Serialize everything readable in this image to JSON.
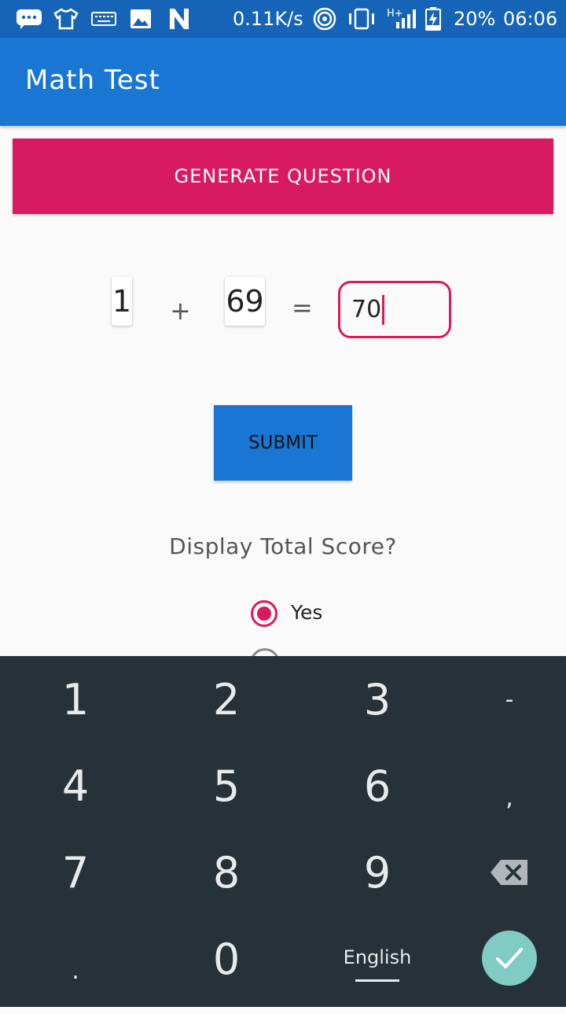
{
  "status_bar": {
    "network_speed": "0.11K/s",
    "network_type": "H+",
    "battery_percent": "20%",
    "time": "06:06",
    "icons": [
      "messages-icon",
      "tshirt-icon",
      "keyboard-icon",
      "image-icon",
      "n-icon",
      "hotspot-icon",
      "vibrate-icon",
      "signal-icon",
      "battery-charging-icon"
    ]
  },
  "app_bar": {
    "title": "Math Test"
  },
  "generate_button": {
    "label": "GENERATE QUESTION"
  },
  "question": {
    "operand1": "1",
    "operator": "+",
    "operand2": "69",
    "equals": "=",
    "answer": "70"
  },
  "submit_button": {
    "label": "SUBMIT"
  },
  "score_prompt": "Display Total Score?",
  "radio_options": [
    {
      "label": "Yes",
      "selected": true
    },
    {
      "label": "",
      "selected": false
    }
  ],
  "keyboard": {
    "rows": [
      [
        "1",
        "2",
        "3",
        "-"
      ],
      [
        "4",
        "5",
        "6",
        ","
      ],
      [
        "7",
        "8",
        "9",
        "backspace"
      ],
      [
        ".",
        "0",
        "English",
        "enter"
      ]
    ],
    "language": "English"
  },
  "colors": {
    "primary": "#1976d2",
    "primary_dark": "#1664b8",
    "accent": "#d81b60",
    "keyboard_bg": "#263238",
    "enter_key": "#80cbc4"
  }
}
